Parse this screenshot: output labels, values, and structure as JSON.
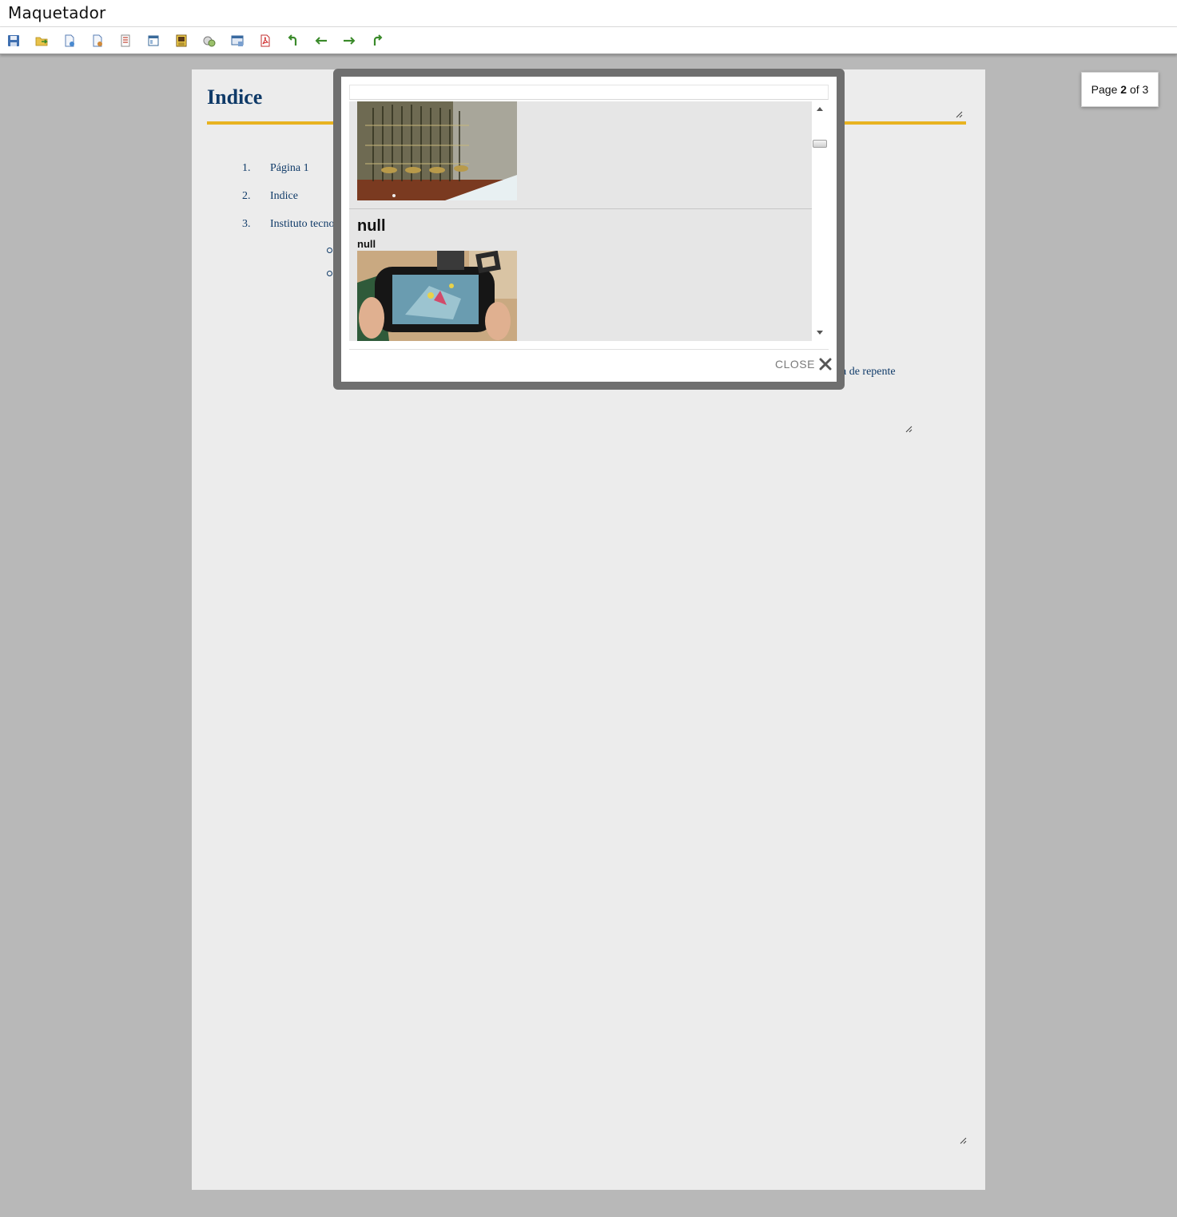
{
  "app": {
    "title": "Maquetador"
  },
  "toolbar": {
    "buttons": [
      {
        "icon": "save-icon"
      },
      {
        "icon": "open-folder-icon"
      },
      {
        "icon": "new-page-icon"
      },
      {
        "icon": "delete-page-icon"
      },
      {
        "icon": "page-properties-icon"
      },
      {
        "icon": "layout-icon"
      },
      {
        "icon": "insert-image-icon"
      },
      {
        "icon": "insert-media-icon"
      },
      {
        "icon": "preview-icon"
      },
      {
        "icon": "pdf-icon"
      },
      {
        "icon": "undo-icon"
      },
      {
        "icon": "previous-page-icon"
      },
      {
        "icon": "next-page-icon"
      },
      {
        "icon": "redo-icon"
      }
    ]
  },
  "page": {
    "title": "Indice",
    "toc": [
      {
        "num": "1.",
        "text": "Página 1"
      },
      {
        "num": "2.",
        "text": "Indice"
      },
      {
        "num": "3.",
        "text": "Instituto tecnolo"
      }
    ],
    "body_fragment": "da de repente"
  },
  "page_indicator": {
    "prefix": "Page",
    "current": "2",
    "of_label": "of",
    "total": "3"
  },
  "modal": {
    "search": {
      "value": "",
      "placeholder": ""
    },
    "items": [
      {
        "title": "",
        "subtitle": "",
        "image": "machine-photo"
      },
      {
        "title": "null",
        "subtitle": "null",
        "image": "handheld-console-photo"
      }
    ],
    "close_label": "CLOSE"
  },
  "colors": {
    "background": "#b8b8b8",
    "page": "#ececec",
    "heading": "#0f3a68",
    "rule": "#e8b321",
    "modal_frame": "#6f6f6f"
  }
}
